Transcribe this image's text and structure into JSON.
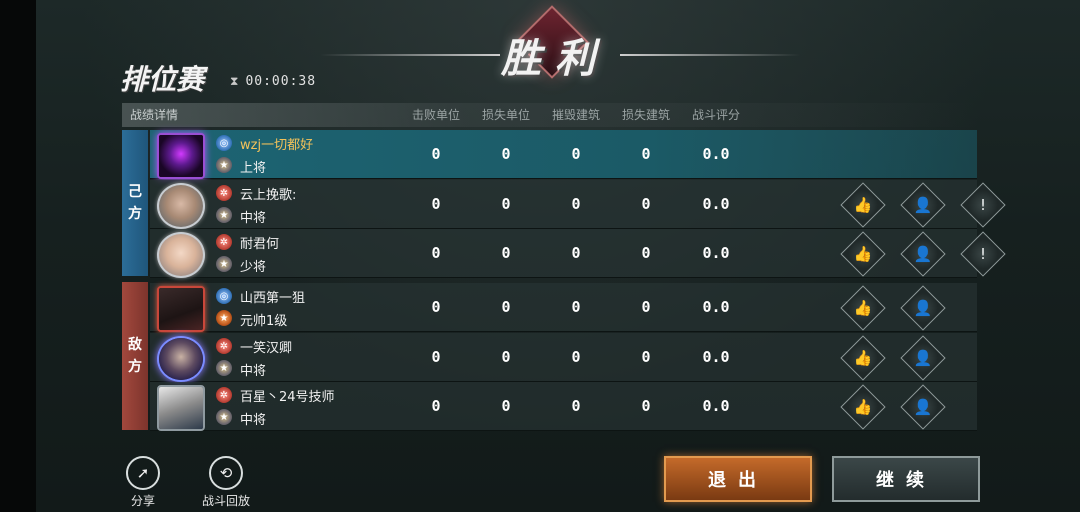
{
  "banner": "胜利",
  "title": "排位赛",
  "timer": "00:00:38",
  "table": {
    "section_label": "战绩详情",
    "columns": [
      "击败单位",
      "损失单位",
      "摧毁建筑",
      "损失建筑",
      "战斗评分"
    ],
    "ally_label": "己方",
    "enemy_label": "敌方",
    "ally": [
      {
        "name": "wzj一切都好",
        "rank": "上将",
        "stats": [
          "0",
          "0",
          "0",
          "0",
          "0.0"
        ]
      },
      {
        "name": "云上挽歌:",
        "rank": "中将",
        "stats": [
          "0",
          "0",
          "0",
          "0",
          "0.0"
        ]
      },
      {
        "name": "耐君何",
        "rank": "少将",
        "stats": [
          "0",
          "0",
          "0",
          "0",
          "0.0"
        ]
      }
    ],
    "enemy": [
      {
        "name": "山西第一狙",
        "rank": "元帅1级",
        "stats": [
          "0",
          "0",
          "0",
          "0",
          "0.0"
        ]
      },
      {
        "name": "一笑汉卿",
        "rank": "中将",
        "stats": [
          "0",
          "0",
          "0",
          "0",
          "0.0"
        ]
      },
      {
        "name": "百星丶24号技师",
        "rank": "中将",
        "stats": [
          "0",
          "0",
          "0",
          "0",
          "0.0"
        ]
      }
    ]
  },
  "icons": {
    "like": "thumbs-up-icon",
    "add_friend": "add-friend-icon",
    "report": "report-icon"
  },
  "bottom": {
    "share_label": "分享",
    "replay_label": "战斗回放",
    "exit_label": "退出",
    "continue_label": "继续"
  },
  "colors": {
    "ally_tab": "#2c6d98",
    "enemy_tab": "#a2483d",
    "highlight_row": "#1d6473",
    "exit_button": "#c46a2a",
    "gold_name": "#f3c25a"
  }
}
